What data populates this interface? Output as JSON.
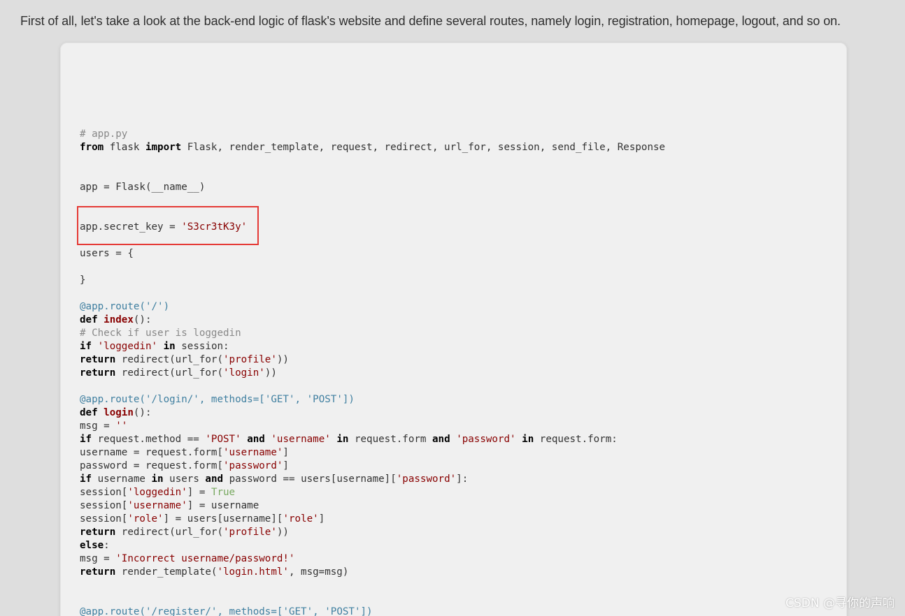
{
  "intro_text": "First of all, let's take a look at the back-end logic of flask's website and define several routes, namely login, registration, homepage, logout, and so on.",
  "code": {
    "l01_comment": "# app.py",
    "l02": {
      "from": "from",
      "mod": " flask ",
      "import": "import",
      "rest": " Flask, render_template, request, redirect, url_for, session, send_file, Response"
    },
    "l05": "app = Flask(__name__)",
    "l08": {
      "pre": "app.secret_key = ",
      "str": "'S3cr3tK3y'"
    },
    "l10": "users = {",
    "l12": "}",
    "l14": {
      "deco": "@app.route(",
      "str": "'/'",
      "end": ")"
    },
    "l15": {
      "def": "def",
      "name": " index",
      "rest": "():"
    },
    "l16_comment": "# Check if user is loggedin",
    "l17": {
      "if": "if",
      "sp": " ",
      "str": "'loggedin'",
      "sp2": " ",
      "in": "in",
      "rest": " session:"
    },
    "l18": {
      "ret": "return",
      "pre": " redirect(url_for(",
      "str": "'profile'",
      "end": "))"
    },
    "l19": {
      "ret": "return",
      "pre": " redirect(url_for(",
      "str": "'login'",
      "end": "))"
    },
    "l21": {
      "deco": "@app.route(",
      "str1": "'/login/'",
      "mid": ", methods=[",
      "str2": "'GET'",
      "comma": ", ",
      "str3": "'POST'",
      "end": "])"
    },
    "l22": {
      "def": "def",
      "name": " login",
      "rest": "():"
    },
    "l23": {
      "pre": "msg = ",
      "str": "''"
    },
    "l24": {
      "if": "if",
      "a": " request.method == ",
      "s1": "'POST'",
      "sp": " ",
      "and1": "and",
      "sp2": " ",
      "s2": "'username'",
      "sp3": " ",
      "in1": "in",
      "b": " request.form ",
      "and2": "and",
      "sp4": " ",
      "s3": "'password'",
      "sp5": " ",
      "in2": "in",
      "c": " request.form:"
    },
    "l25": {
      "pre": "username = request.form[",
      "str": "'username'",
      "end": "]"
    },
    "l26": {
      "pre": "password = request.form[",
      "str": "'password'",
      "end": "]"
    },
    "l27": {
      "if": "if",
      "a": " username ",
      "in": "in",
      "b": " users ",
      "and": "and",
      "c": " password == users[username][",
      "str": "'password'",
      "end": "]:"
    },
    "l28": {
      "pre": "session[",
      "str": "'loggedin'",
      "mid": "] = ",
      "lit": "True"
    },
    "l29": {
      "pre": "session[",
      "str": "'username'",
      "end": "] = username"
    },
    "l30": {
      "pre": "session[",
      "str1": "'role'",
      "mid": "] = users[username][",
      "str2": "'role'",
      "end": "]"
    },
    "l31": {
      "ret": "return",
      "pre": " redirect(url_for(",
      "str": "'profile'",
      "end": "))"
    },
    "l32": {
      "else": "else",
      "end": ":"
    },
    "l33": {
      "pre": "msg = ",
      "str": "'Incorrect username/password!'"
    },
    "l34": {
      "ret": "return",
      "pre": " render_template(",
      "str": "'login.html'",
      "end": ", msg=msg)"
    },
    "l37": {
      "deco": "@app.route(",
      "str1": "'/register/'",
      "mid": ", methods=[",
      "str2": "'GET'",
      "comma": ", ",
      "str3": "'POST'",
      "end": "])"
    }
  },
  "watermark": "CSDN @寻你的声响",
  "colors": {
    "page_bg": "#dedede",
    "card_bg": "#f0f0f0",
    "highlight_border": "#e53935",
    "string": "#880000",
    "comment": "#888888",
    "decorator": "#3f7fa0",
    "literal_true": "#78a960"
  }
}
